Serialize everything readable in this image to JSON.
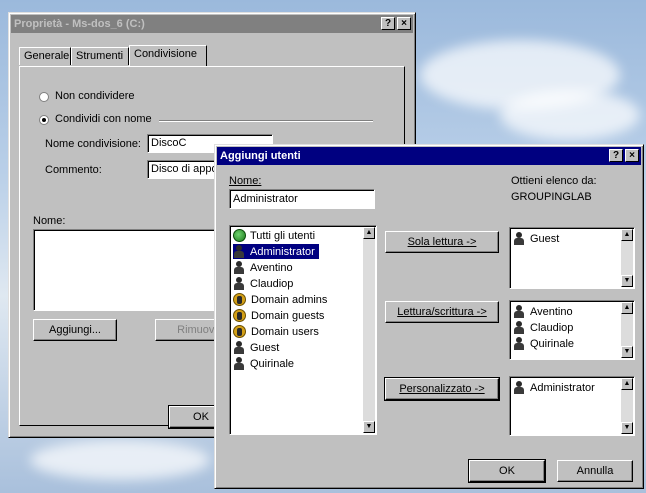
{
  "bg_window": {
    "title": "Proprietà - Ms-dos_6 (C:)",
    "help_btn": "?",
    "close_btn": "×",
    "tabs": [
      "Generale",
      "Strumenti",
      "Condivisione"
    ],
    "radio_no_share": "Non condividere",
    "radio_share": "Condividi con nome",
    "share_name_label": "Nome condivisione:",
    "share_name_value": "DiscoC",
    "comment_label": "Commento:",
    "comment_value": "Disco di appoggio",
    "name_label": "Nome:",
    "add_button": "Aggiungi...",
    "remove_button": "Rimuovi",
    "ok_button": "OK"
  },
  "dialog": {
    "title": "Aggiungi utenti",
    "help_btn": "?",
    "close_btn": "×",
    "name_label": "Nome:",
    "name_value": "Administrator",
    "get_list_label": "Ottieni elenco da:",
    "get_list_value": "GROUPINGLAB",
    "users": [
      {
        "label": "Tutti gli utenti",
        "icon": "world-icon",
        "selected": false
      },
      {
        "label": "Administrator",
        "icon": "user-icon",
        "selected": true
      },
      {
        "label": "Aventino",
        "icon": "user-icon",
        "selected": false
      },
      {
        "label": "Claudiop",
        "icon": "user-icon",
        "selected": false
      },
      {
        "label": "Domain admins",
        "icon": "group-icon",
        "selected": false
      },
      {
        "label": "Domain guests",
        "icon": "group-icon",
        "selected": false
      },
      {
        "label": "Domain users",
        "icon": "group-icon",
        "selected": false
      },
      {
        "label": "Guest",
        "icon": "user-icon",
        "selected": false
      },
      {
        "label": "Quirinale",
        "icon": "user-icon",
        "selected": false
      }
    ],
    "readonly_button": "Sola lettura ->",
    "readwrite_button": "Lettura/scrittura ->",
    "custom_button": "Personalizzato ->",
    "readonly_list": [
      "Guest"
    ],
    "readwrite_list": [
      "Aventino",
      "Claudiop",
      "Quirinale"
    ],
    "custom_list": [
      "Administrator"
    ],
    "ok_button": "OK",
    "cancel_button": "Annulla"
  }
}
